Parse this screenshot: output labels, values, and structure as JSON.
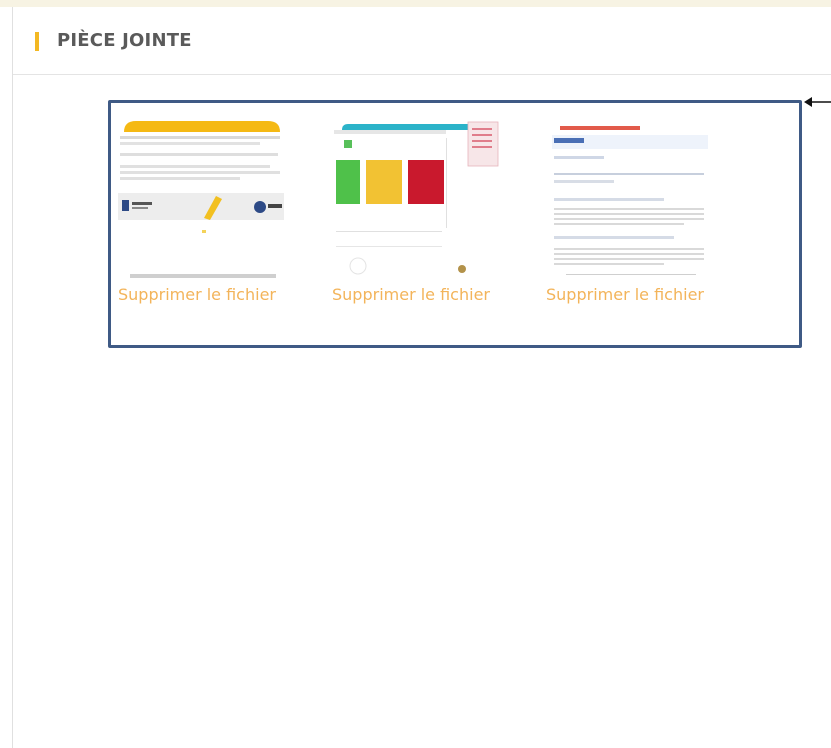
{
  "panel": {
    "title": "PIÈCE JOINTE",
    "accent_color": "#f3b823"
  },
  "highlight": {
    "border_color": "#3f5a85",
    "arrow_icon": "arrow-left-icon"
  },
  "attachments": [
    {
      "delete_label": "Supprimer le fichier",
      "thumbnail": "document-preview-1"
    },
    {
      "delete_label": "Supprimer le fichier",
      "thumbnail": "dashboard-preview"
    },
    {
      "delete_label": "Supprimer le fichier",
      "thumbnail": "form-document-preview"
    }
  ]
}
